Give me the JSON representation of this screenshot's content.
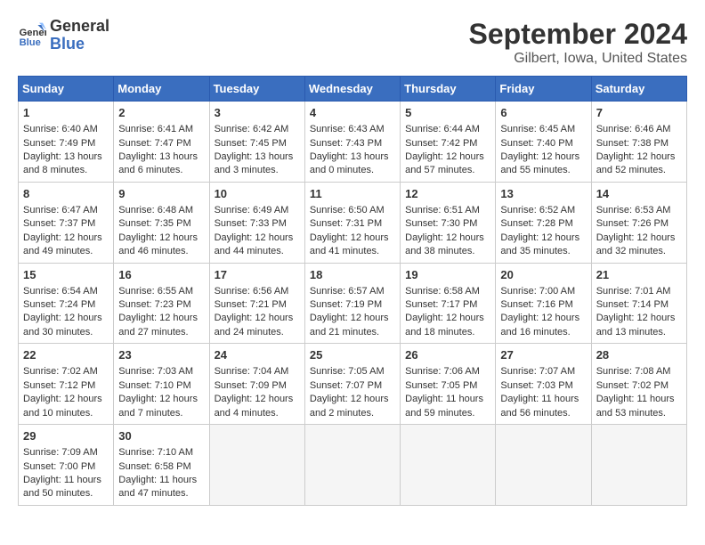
{
  "logo": {
    "line1": "General",
    "line2": "Blue"
  },
  "title": "September 2024",
  "subtitle": "Gilbert, Iowa, United States",
  "weekdays": [
    "Sunday",
    "Monday",
    "Tuesday",
    "Wednesday",
    "Thursday",
    "Friday",
    "Saturday"
  ],
  "weeks": [
    [
      {
        "day": 1,
        "sunrise": "6:40 AM",
        "sunset": "7:49 PM",
        "daylight": "13 hours and 8 minutes."
      },
      {
        "day": 2,
        "sunrise": "6:41 AM",
        "sunset": "7:47 PM",
        "daylight": "13 hours and 6 minutes."
      },
      {
        "day": 3,
        "sunrise": "6:42 AM",
        "sunset": "7:45 PM",
        "daylight": "13 hours and 3 minutes."
      },
      {
        "day": 4,
        "sunrise": "6:43 AM",
        "sunset": "7:43 PM",
        "daylight": "13 hours and 0 minutes."
      },
      {
        "day": 5,
        "sunrise": "6:44 AM",
        "sunset": "7:42 PM",
        "daylight": "12 hours and 57 minutes."
      },
      {
        "day": 6,
        "sunrise": "6:45 AM",
        "sunset": "7:40 PM",
        "daylight": "12 hours and 55 minutes."
      },
      {
        "day": 7,
        "sunrise": "6:46 AM",
        "sunset": "7:38 PM",
        "daylight": "12 hours and 52 minutes."
      }
    ],
    [
      {
        "day": 8,
        "sunrise": "6:47 AM",
        "sunset": "7:37 PM",
        "daylight": "12 hours and 49 minutes."
      },
      {
        "day": 9,
        "sunrise": "6:48 AM",
        "sunset": "7:35 PM",
        "daylight": "12 hours and 46 minutes."
      },
      {
        "day": 10,
        "sunrise": "6:49 AM",
        "sunset": "7:33 PM",
        "daylight": "12 hours and 44 minutes."
      },
      {
        "day": 11,
        "sunrise": "6:50 AM",
        "sunset": "7:31 PM",
        "daylight": "12 hours and 41 minutes."
      },
      {
        "day": 12,
        "sunrise": "6:51 AM",
        "sunset": "7:30 PM",
        "daylight": "12 hours and 38 minutes."
      },
      {
        "day": 13,
        "sunrise": "6:52 AM",
        "sunset": "7:28 PM",
        "daylight": "12 hours and 35 minutes."
      },
      {
        "day": 14,
        "sunrise": "6:53 AM",
        "sunset": "7:26 PM",
        "daylight": "12 hours and 32 minutes."
      }
    ],
    [
      {
        "day": 15,
        "sunrise": "6:54 AM",
        "sunset": "7:24 PM",
        "daylight": "12 hours and 30 minutes."
      },
      {
        "day": 16,
        "sunrise": "6:55 AM",
        "sunset": "7:23 PM",
        "daylight": "12 hours and 27 minutes."
      },
      {
        "day": 17,
        "sunrise": "6:56 AM",
        "sunset": "7:21 PM",
        "daylight": "12 hours and 24 minutes."
      },
      {
        "day": 18,
        "sunrise": "6:57 AM",
        "sunset": "7:19 PM",
        "daylight": "12 hours and 21 minutes."
      },
      {
        "day": 19,
        "sunrise": "6:58 AM",
        "sunset": "7:17 PM",
        "daylight": "12 hours and 18 minutes."
      },
      {
        "day": 20,
        "sunrise": "7:00 AM",
        "sunset": "7:16 PM",
        "daylight": "12 hours and 16 minutes."
      },
      {
        "day": 21,
        "sunrise": "7:01 AM",
        "sunset": "7:14 PM",
        "daylight": "12 hours and 13 minutes."
      }
    ],
    [
      {
        "day": 22,
        "sunrise": "7:02 AM",
        "sunset": "7:12 PM",
        "daylight": "12 hours and 10 minutes."
      },
      {
        "day": 23,
        "sunrise": "7:03 AM",
        "sunset": "7:10 PM",
        "daylight": "12 hours and 7 minutes."
      },
      {
        "day": 24,
        "sunrise": "7:04 AM",
        "sunset": "7:09 PM",
        "daylight": "12 hours and 4 minutes."
      },
      {
        "day": 25,
        "sunrise": "7:05 AM",
        "sunset": "7:07 PM",
        "daylight": "12 hours and 2 minutes."
      },
      {
        "day": 26,
        "sunrise": "7:06 AM",
        "sunset": "7:05 PM",
        "daylight": "11 hours and 59 minutes."
      },
      {
        "day": 27,
        "sunrise": "7:07 AM",
        "sunset": "7:03 PM",
        "daylight": "11 hours and 56 minutes."
      },
      {
        "day": 28,
        "sunrise": "7:08 AM",
        "sunset": "7:02 PM",
        "daylight": "11 hours and 53 minutes."
      }
    ],
    [
      {
        "day": 29,
        "sunrise": "7:09 AM",
        "sunset": "7:00 PM",
        "daylight": "11 hours and 50 minutes."
      },
      {
        "day": 30,
        "sunrise": "7:10 AM",
        "sunset": "6:58 PM",
        "daylight": "11 hours and 47 minutes."
      },
      null,
      null,
      null,
      null,
      null
    ]
  ]
}
